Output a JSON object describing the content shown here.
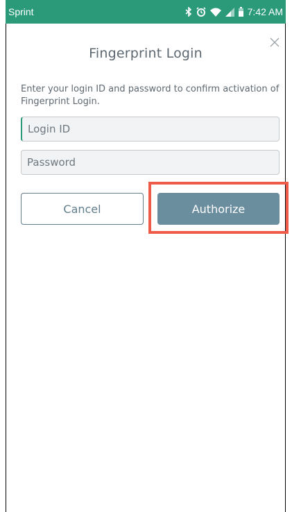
{
  "status_bar": {
    "carrier": "Sprint",
    "time": "7:42 AM",
    "icons": [
      "bluetooth-icon",
      "alarm-icon",
      "wifi-icon",
      "signal-icon",
      "battery-icon"
    ],
    "background_color": "#2a9a79"
  },
  "dialog": {
    "title": "Fingerprint Login",
    "close_icon": "close-icon",
    "instructions": "Enter your login ID and password to confirm activation of Fingerprint Login.",
    "login_field": {
      "placeholder": "Login ID",
      "value": ""
    },
    "password_field": {
      "placeholder": "Password",
      "value": ""
    },
    "cancel_label": "Cancel",
    "authorize_label": "Authorize"
  },
  "colors": {
    "accent": "#2a9a79",
    "button_primary": "#6b8e9f",
    "button_outline": "#5f7d8c",
    "highlight": "#f05a48"
  }
}
